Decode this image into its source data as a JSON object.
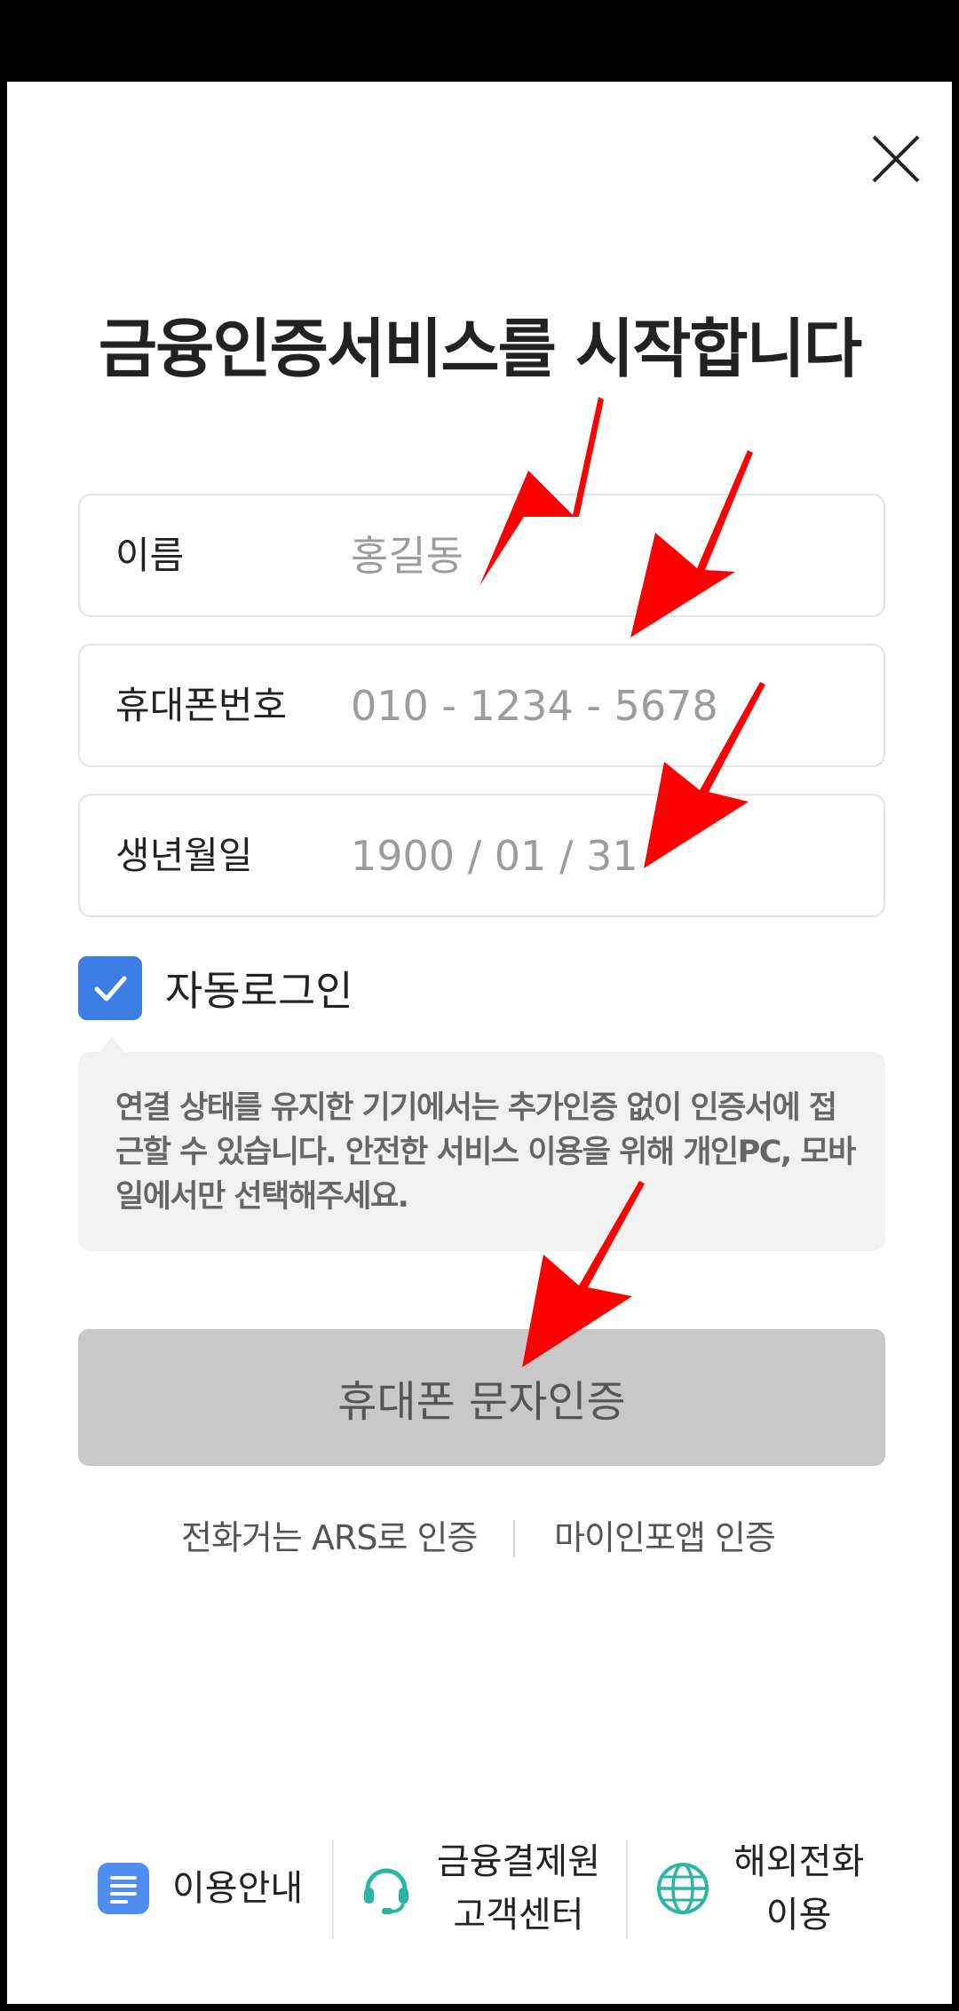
{
  "header": {
    "close_icon": "close-icon"
  },
  "title": "금융인증서비스를 시작합니다",
  "form": {
    "name": {
      "label": "이름",
      "placeholder": "홍길동"
    },
    "phone": {
      "label": "휴대폰번호",
      "placeholder": "010 - 1234 - 5678"
    },
    "birth": {
      "label": "생년월일",
      "placeholder": "1900 / 01 / 31"
    }
  },
  "auto_login": {
    "label": "자동로그인",
    "checked": true
  },
  "tooltip": {
    "text": "연결 상태를 유지한 기기에서는 추가인증 없이 인증서에 접근할 수 있습니다. 안전한 서비스 이용을 위해 개인PC, 모바일에서만 선택해주세요."
  },
  "primary_button": {
    "label": "휴대폰 문자인증"
  },
  "alt_auth": {
    "ars": "전화거는 ARS로 인증",
    "myinfo": "마이인포앱 인증"
  },
  "footer": {
    "guide": {
      "label": "이용안내",
      "icon": "document-icon"
    },
    "center": {
      "line1": "금융결제원",
      "line2": "고객센터",
      "icon": "headset-icon"
    },
    "intl": {
      "line1": "해외전화",
      "line2": "이용",
      "icon": "globe-icon"
    }
  },
  "colors": {
    "accent": "#3d7ee6",
    "button_disabled": "#c8c8c8",
    "tooltip_bg": "#f1f1f1",
    "annotation_arrow": "#ff0000"
  }
}
